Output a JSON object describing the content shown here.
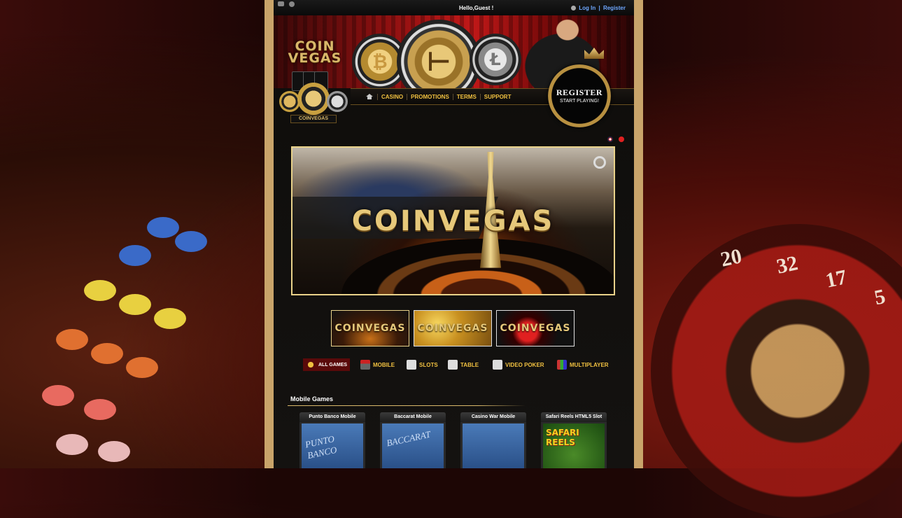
{
  "topbar": {
    "greeting": "Hello,Guest !",
    "login": "Log In",
    "separator": "|",
    "register": "Register"
  },
  "logo": {
    "line1": "COIN",
    "line2": "VEGAS",
    "badge": "COINVEGAS"
  },
  "nav": {
    "items": [
      "CASINO",
      "PROMOTIONS",
      "TERMS",
      "SUPPORT"
    ]
  },
  "register_badge": {
    "title": "REGISTER",
    "subtitle": "START PLAYING!"
  },
  "banner": {
    "text": "COINVEGAS"
  },
  "thumbs": [
    "COINVEGAS",
    "COINVEGAS",
    "COINVEGAS"
  ],
  "categories": [
    "ALL GAMES",
    "MOBILE",
    "SLOTS",
    "TABLE",
    "VIDEO POKER",
    "MULTIPLAYER"
  ],
  "section": {
    "title": "Mobile Games"
  },
  "games": [
    {
      "title": "Punto Banco Mobile",
      "art": "PUNTO BANCO"
    },
    {
      "title": "Baccarat Mobile",
      "art": "BACCARAT"
    },
    {
      "title": "Casino War Mobile",
      "art": ""
    },
    {
      "title": "Safari Reels HTML5 Slot",
      "art": "SAFARI REELS"
    }
  ],
  "background": {
    "wheel_numbers": [
      "20",
      "32",
      "17",
      "5"
    ]
  },
  "colors": {
    "gold": "#d9b86a",
    "nav_text": "#f0c040",
    "link_blue": "#6fa8ff",
    "column": "#c9a46a"
  }
}
